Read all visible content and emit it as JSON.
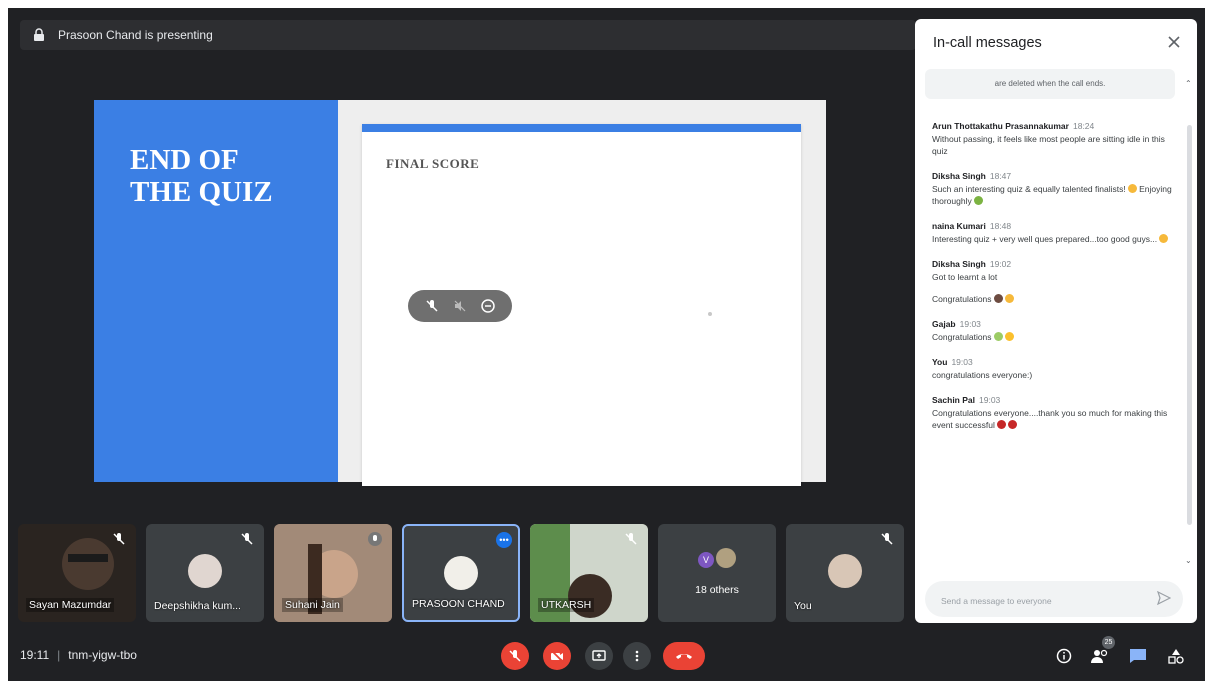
{
  "presenting_banner": "Prasoon Chand is presenting",
  "slide": {
    "title_line1": "END OF",
    "title_line2": "THE QUIZ",
    "card_label": "FINAL SCORE"
  },
  "tiles": [
    {
      "name": "Sayan Mazumdar",
      "type": "video"
    },
    {
      "name": "Deepshikha kum...",
      "type": "avatar"
    },
    {
      "name": "Suhani Jain",
      "type": "video"
    },
    {
      "name": "PRASOON CHAND",
      "type": "avatar",
      "active": true
    },
    {
      "name": "UTKARSH",
      "type": "video"
    },
    {
      "name": "18 others",
      "type": "group",
      "initial": "V"
    },
    {
      "name": "You",
      "type": "avatar"
    }
  ],
  "meeting": {
    "time": "19:11",
    "code": "tnm-yigw-tbo"
  },
  "participants_count": "25",
  "chat": {
    "header": "In-call messages",
    "notice": "are deleted when the call ends.",
    "messages": [
      {
        "sender": "Arun Thottakathu Prasannakumar",
        "time": "18:24",
        "lines": [
          "Without passing, it feels like most people are sitting idle in this quiz"
        ]
      },
      {
        "sender": "Diksha Singh",
        "time": "18:47",
        "lines": [
          "Such an interesting quiz & equally talented finalists!",
          "Enjoying thoroughly"
        ]
      },
      {
        "sender": "naina Kumari",
        "time": "18:48",
        "lines": [
          "Interesting quiz + very well ques prepared...too good guys..."
        ]
      },
      {
        "sender": "Diksha Singh",
        "time": "19:02",
        "lines": [
          "Got to learnt a lot",
          "Congratulations"
        ]
      },
      {
        "sender": "Gajab",
        "time": "19:03",
        "lines": [
          "Congratulations"
        ]
      },
      {
        "sender": "You",
        "time": "19:03",
        "lines": [
          "congratulations everyone:)"
        ]
      },
      {
        "sender": "Sachin Pal",
        "time": "19:03",
        "lines": [
          "Congratulations everyone....thank you so much for making this event successful"
        ]
      }
    ],
    "input_placeholder": "Send a message to everyone"
  },
  "colors": {
    "stage_bg": "#202124",
    "slide_blue": "#3b7fe4",
    "end_call_red": "#ea4335",
    "chat_blue": "#1a73e8"
  }
}
